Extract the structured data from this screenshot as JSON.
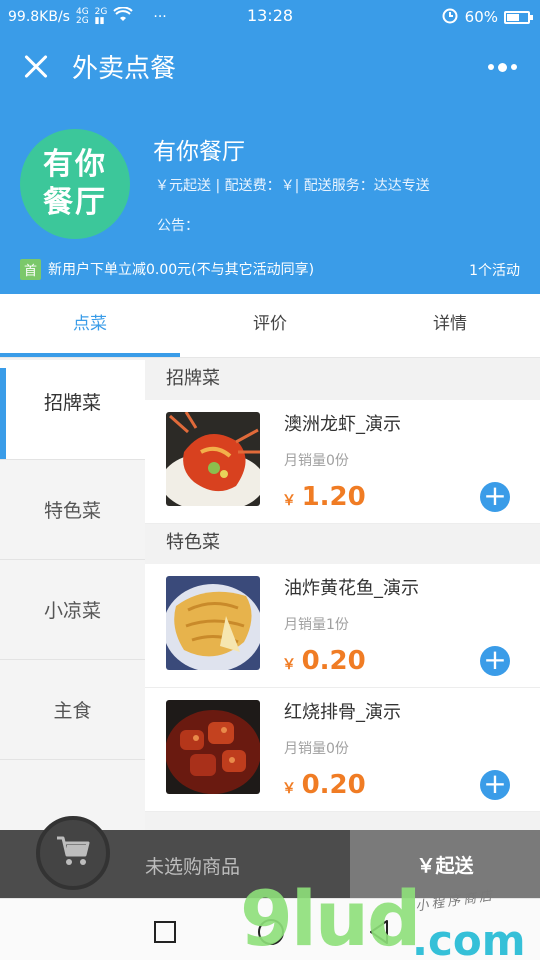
{
  "status_bar": {
    "speed": "99.8KB/s",
    "time": "13:28",
    "battery": "60%",
    "battery_level": 0.6,
    "dots": "···"
  },
  "header": {
    "title": "外卖点餐",
    "shop_logo_line1": "有你",
    "shop_logo_line2": "餐厅",
    "shop_name": "有你餐厅",
    "shop_meta": "￥元起送 | 配送费：￥| 配送服务：达达专送",
    "notice": "公告：",
    "promo_tag": "首",
    "promo_text": "新用户下单立减0.00元(不与其它活动同享)",
    "promo_count": "1个活动"
  },
  "tabs": [
    {
      "label": "点菜",
      "active": true
    },
    {
      "label": "评价",
      "active": false
    },
    {
      "label": "详情",
      "active": false
    }
  ],
  "sidebar": {
    "categories": [
      {
        "label": "招牌菜",
        "active": true
      },
      {
        "label": "特色菜",
        "active": false
      },
      {
        "label": "小凉菜",
        "active": false
      },
      {
        "label": "主食",
        "active": false
      }
    ]
  },
  "menu": {
    "sections": [
      {
        "title": "招牌菜",
        "items": [
          {
            "name": "澳洲龙虾_演示",
            "sales": "月销量0份",
            "currency": "￥",
            "price": "1.20",
            "image": "lobster-dish"
          }
        ]
      },
      {
        "title": "特色菜",
        "items": [
          {
            "name": "油炸黄花鱼_演示",
            "sales": "月销量1份",
            "currency": "￥",
            "price": "0.20",
            "image": "fried-fish-dish"
          },
          {
            "name": "红烧排骨_演示",
            "sales": "月销量0份",
            "currency": "￥",
            "price": "0.20",
            "image": "braised-ribs-dish"
          }
        ]
      }
    ]
  },
  "cart": {
    "empty_text": "未选购商品",
    "checkout_label": "￥起送"
  },
  "watermark": {
    "big": "9lud",
    "com": ".com",
    "small": "小程序商店"
  },
  "colors": {
    "primary": "#3a9ce8",
    "price": "#f07c24",
    "logo": "#3cc79a"
  }
}
